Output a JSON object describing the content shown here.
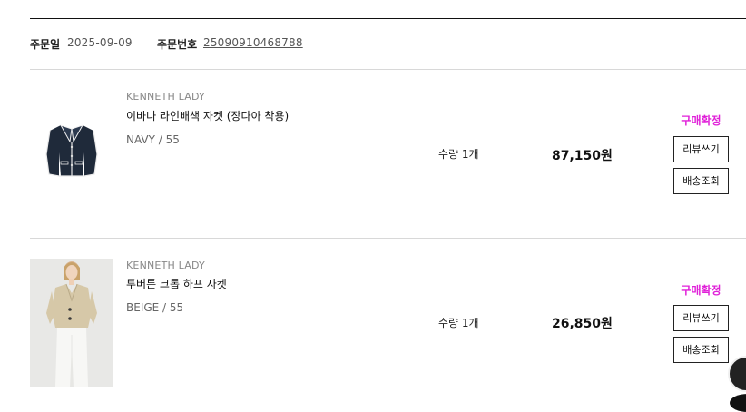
{
  "order": {
    "date_label": "주문일",
    "date_value": "2025-09-09",
    "number_label": "주문번호",
    "number_value": "25090910468788"
  },
  "items": [
    {
      "brand": "KENNETH LADY",
      "name": "이바나 라인배색 자켓 (장다아 착용)",
      "option": "NAVY / 55",
      "qty": "수량 1개",
      "price": "87,150원",
      "status": "구매확정",
      "review_label": "리뷰쓰기",
      "tracking_label": "배송조회",
      "thumb_icon": "navy-cropped-jacket-image"
    },
    {
      "brand": "KENNETH LADY",
      "name": "투버튼 크롭 하프 자켓",
      "option": "BEIGE / 55",
      "qty": "수량 1개",
      "price": "26,850원",
      "status": "구매확정",
      "review_label": "리뷰쓰기",
      "tracking_label": "배송조회",
      "thumb_icon": "beige-jacket-model-image"
    }
  ],
  "colors": {
    "status": "#e020d8",
    "navy": "#1f2a3a",
    "beige": "#d6c8a8"
  },
  "floating": {
    "icon": "chat-avatar-icon"
  }
}
